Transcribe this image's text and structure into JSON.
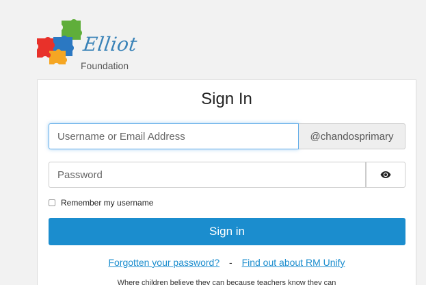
{
  "logo": {
    "script_text": "Elliot",
    "sub_text": "Foundation",
    "colors": {
      "red": "#e8312a",
      "green": "#5fae3a",
      "blue": "#2b78c2",
      "yellow": "#f5a623",
      "script": "#3a83b8"
    }
  },
  "form": {
    "title": "Sign In",
    "username_placeholder": "Username or Email Address",
    "domain_suffix": "@chandosprimary",
    "password_placeholder": "Password",
    "show_password_icon": "eye-icon",
    "remember_label": "Remember my username",
    "signin_label": "Sign in",
    "forgot_link": "Forgotten your password?",
    "separator": "-",
    "rm_unify_link": "Find out about RM Unify",
    "tagline": "Where children believe they can because teachers know they can"
  },
  "colors": {
    "primary": "#1b8dce",
    "background": "#f2f2f2",
    "focus": "#66afe9"
  }
}
